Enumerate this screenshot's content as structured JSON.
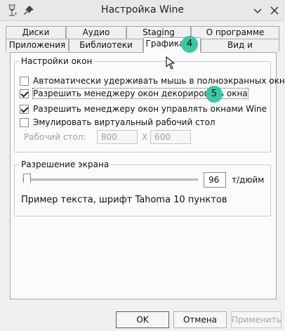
{
  "window": {
    "title": "Настройка Wine"
  },
  "tabs_row1": [
    {
      "label": "Диски"
    },
    {
      "label": "Аудио"
    },
    {
      "label": "Staging"
    },
    {
      "label": "О программе"
    }
  ],
  "tabs_row2": [
    {
      "label": "Приложения"
    },
    {
      "label": "Библиотеки"
    },
    {
      "label": "Графика"
    },
    {
      "label": "Вид и интеграция"
    }
  ],
  "window_settings": {
    "legend": "Настройки окон",
    "options": [
      {
        "label": "Автоматически удерживать мышь в полноэкранных окнах",
        "checked": false
      },
      {
        "label": "Разрешить менеджеру окон декорировать окна",
        "checked": true
      },
      {
        "label": "Разрешить менеджеру окон управлять окнами Wine",
        "checked": true
      },
      {
        "label": "Эмулировать виртуальный рабочий стол",
        "checked": false
      }
    ],
    "desktop_label": "Рабочий стол:",
    "desktop_width": "800",
    "desktop_x": "X",
    "desktop_height": "600"
  },
  "screen_resolution": {
    "legend": "Разрешение экрана",
    "dpi_value": "96",
    "unit": "т/дюйм",
    "sample_text": "Пример текста, шрифт Tahoma 10 пунктов"
  },
  "markers": {
    "tab": "4",
    "option": "5"
  },
  "buttons": {
    "ok": "OK",
    "cancel": "Отмена",
    "apply": "Применить"
  },
  "colors": {
    "marker": "#3cc7a4"
  }
}
